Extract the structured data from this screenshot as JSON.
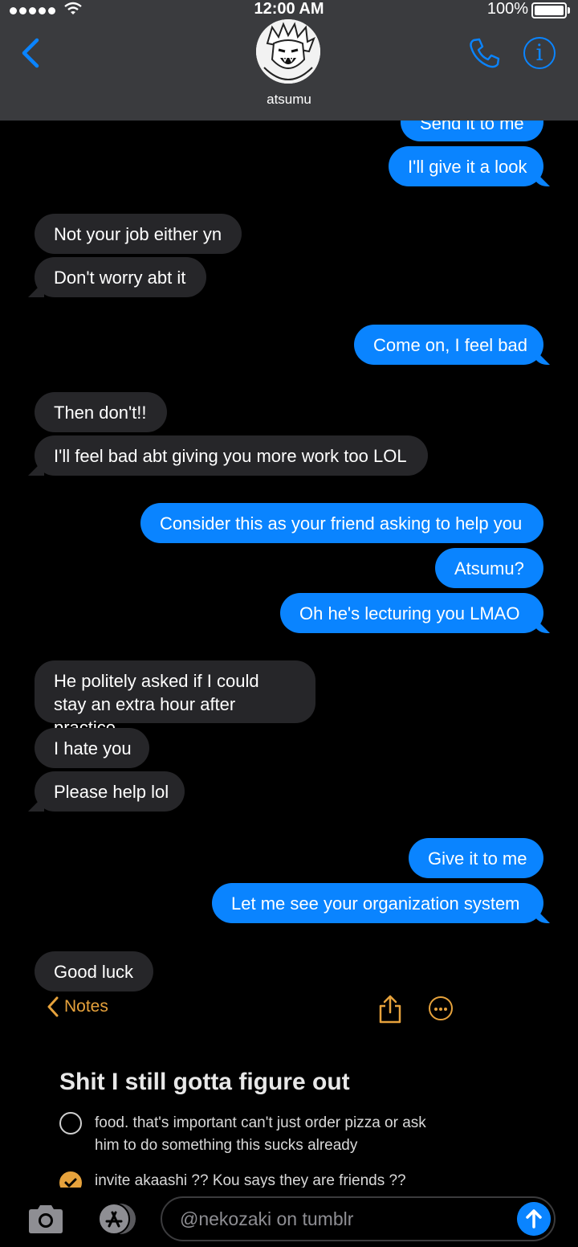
{
  "status_bar": {
    "time": "12:00 AM",
    "battery": "100%"
  },
  "header": {
    "contact_name": "atsumu"
  },
  "messages": [
    {
      "side": "sent",
      "text": "Send it to me"
    },
    {
      "side": "sent",
      "text": "I'll give it a look"
    },
    {
      "side": "recv",
      "text": "Not your job either yn"
    },
    {
      "side": "recv",
      "text": "Don't worry abt it"
    },
    {
      "side": "sent",
      "text": "Come on, I feel bad"
    },
    {
      "side": "recv",
      "text": "Then don't!!"
    },
    {
      "side": "recv",
      "text": "I'll feel bad abt giving you more work too LOL"
    },
    {
      "side": "sent",
      "text": "Consider this as your friend asking to help you"
    },
    {
      "side": "sent",
      "text": "Atsumu?"
    },
    {
      "side": "sent",
      "text": "Oh he's lecturing you LMAO"
    },
    {
      "side": "recv",
      "text": "He politely asked if I could stay an extra hour after practice"
    },
    {
      "side": "recv",
      "text": "I hate you"
    },
    {
      "side": "recv",
      "text": "Please help lol"
    },
    {
      "side": "sent",
      "text": "Give it to me"
    },
    {
      "side": "sent",
      "text": "Let me see your organization system"
    },
    {
      "side": "recv",
      "text": "Good luck"
    }
  ],
  "notes": {
    "back_label": "Notes",
    "title": "Shit I still gotta figure out",
    "items": [
      {
        "text": "food. that's important can't just order pizza or ask him to do something this sucks already",
        "checked": false
      },
      {
        "text": "invite akaashi ?? Kou says they are friends ??",
        "checked": true
      }
    ]
  },
  "composer": {
    "placeholder": "@nekozaki on tumblr"
  },
  "colors": {
    "sent_bubble": "#0a84ff",
    "recv_bubble": "#262629",
    "notes_accent": "#e6a23c",
    "header_bg": "#3a3b3e"
  },
  "icons": [
    "back-chevron-icon",
    "phone-icon",
    "info-icon",
    "share-icon",
    "more-icon",
    "camera-icon",
    "app-store-icon",
    "send-arrow-icon"
  ]
}
